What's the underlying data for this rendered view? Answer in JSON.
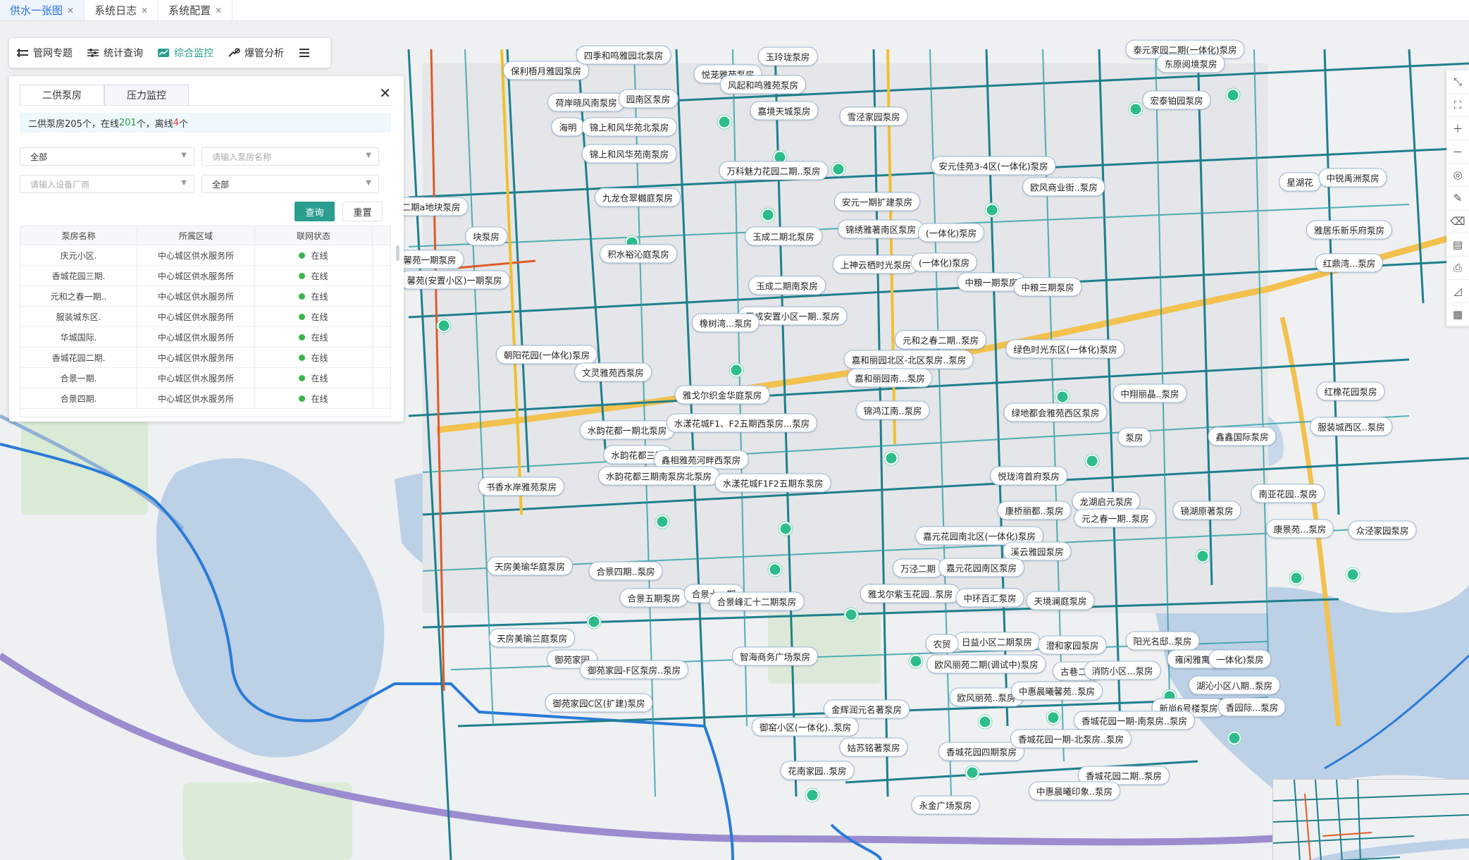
{
  "tabs": [
    {
      "label": "供水一张图",
      "active": true
    },
    {
      "label": "系统日志",
      "active": false
    },
    {
      "label": "系统配置",
      "active": false
    }
  ],
  "toolbar": {
    "items": [
      {
        "label": "管网专题",
        "icon": "pipe-network-icon"
      },
      {
        "label": "统计查询",
        "icon": "sliders-icon"
      },
      {
        "label": "综合监控",
        "icon": "chart-monitor-icon",
        "active": true
      },
      {
        "label": "爆管分析",
        "icon": "burst-analysis-icon"
      }
    ],
    "more_icon": "menu-icon"
  },
  "panel": {
    "tabs": [
      "二供泵房",
      "压力监控"
    ],
    "summary": {
      "prefix": "二供泵房205个，在线",
      "online": "201",
      "mid": "个，离线",
      "offline": "4",
      "suffix": "个"
    },
    "filters": {
      "area": "全部",
      "pump_name_placeholder": "请输入泵房名称",
      "vendor_placeholder": "请输入设备厂商",
      "status": "全部"
    },
    "buttons": {
      "query": "查询",
      "reset": "重置"
    },
    "columns": [
      "泵房名称",
      "所属区域",
      "联网状态"
    ],
    "rows": [
      [
        "庆元小区.",
        "中心城区供水服务所",
        "在线"
      ],
      [
        "香城花园三期.",
        "中心城区供水服务所",
        "在线"
      ],
      [
        "元和之春一期..",
        "中心城区供水服务所",
        "在线"
      ],
      [
        "服装城东区.",
        "中心城区供水服务所",
        "在线"
      ],
      [
        "华城国际.",
        "中心城区供水服务所",
        "在线"
      ],
      [
        "香城花园二期.",
        "中心城区供水服务所",
        "在线"
      ],
      [
        "合景一期.",
        "中心城区供水服务所",
        "在线"
      ],
      [
        "合景四期.",
        "中心城区供水服务所",
        "在线"
      ]
    ]
  },
  "map_labels": [
    "保利梧月雅园泵房",
    "四季和鸣雅园北泵房",
    "玉玲珑泵房",
    "悦茏雅苑泵房",
    "风起和鸣雅苑泵房",
    "荷岸晓风南泵房",
    "园南区泵房",
    "嘉境天城泵房",
    "雪泾家园泵房",
    "海明",
    "锦上和风华苑北泵房",
    "锦上和风华苑南泵房",
    "万科魅力花园二期..泵房",
    "九龙仓翠樾庭泵房",
    "安元佳苑3-4区(一体化)泵房",
    "欧风商业街..泵房",
    "泰元家园二期(一体化)泵房",
    "东原阅境泵房",
    "宏泰铂园泵房",
    "星湖花",
    "中锐禹洲泵房",
    "雅居乐新乐府泵房",
    "红鼎湾...泵房",
    "安元一期扩建泵房",
    "锦绣雅著南区泵房",
    "(一体化)泵房",
    "积水裕沁庭泵房",
    "二期a地块泵房",
    "玉成二期北泵房",
    "上神云栖时光泵房",
    "(一体化)泵房",
    "中粮一期泵房",
    "中粮三期泵房",
    "馨苑一期泵房",
    "馨苑(安置小区)一期泵房",
    "玉成二期南泵房",
    "玉成安置小区一期..泵房",
    "橡树湾...泵房",
    "元和之春二期..泵房",
    "绿色时光东区(一体化)泵房",
    "嘉和丽园北区-北区泵房..泵房",
    "朝阳花园(一体化)泵房",
    "文灵雅苑西泵房",
    "嘉和丽园南...泵房",
    "雅戈尔织金华庭泵房",
    "中翔丽晶..泵房",
    "红橡花园泵房",
    "锦鸿江南..泵房",
    "绿地都会雅苑西区泵房",
    "水韵花都一期北泵房",
    "水漾花城F1、F2五期西泵房...泵房",
    "鑫鑫国际泵房",
    "服装城西区..泵房",
    "水韵花都三期",
    "鑫相雅苑河畔西泵房",
    "水韵花都三期南泵房北泵房",
    "水漾花城F1F2五期东泵房",
    "悦珑湾首府泵房",
    "书香水岸雅苑泵房",
    "龙湖启元泵房",
    "康桥丽都..泵房",
    "元之春一期..泵房",
    "镜湖原著泵房",
    "南亚花园..泵房",
    "康景苑...泵房",
    "众泾家园泵房",
    "嘉元花园南北区(一体化)泵房",
    "溪云雅园泵房",
    "天房美瑜华庭泵房",
    "合景四期..泵房",
    "万泾二期",
    "嘉元花园南区泵房",
    "合景五期泵房",
    "合景十一期",
    "合景峰汇十二期泵房",
    "雅戈尔紫玉花园..泵房",
    "中环百汇泵房",
    "天境澜庭泵房",
    "天房美瑜兰庭泵房",
    "日益小区二期泵房",
    "澄和家园泵房",
    "阳光名邸..泵房",
    "御苑家园",
    "智海商务广场泵房",
    "欧风丽苑二期(调试中)泵房",
    "古巷二社",
    "消防小区...泵房",
    "雍闲雅寓泵房",
    "一体化)泵房",
    "御苑家园-F区泵房..泵房",
    "湖沁小区八期..泵房",
    "御苑家园C区(扩建)泵房",
    "金辉润元名著泵房",
    "欧风丽苑..泵房",
    "中惠晨曦馨苑..泵房",
    "新尚6号楼泵房",
    "香园际...泵房",
    "御窑小区(一体化)..泵房",
    "香城花园一期-南泵房..泵房",
    "姑苏铭著泵房",
    "香城花园四期泵房",
    "香城花园一期-北泵房..泵房",
    "花南家园..泵房",
    "香城花园二期..泵房",
    "永金广场泵房",
    "中惠晨曦印象..泵房",
    "农贸",
    "块泵房",
    "泵房"
  ],
  "right_tools": [
    "measure-icon",
    "fullscreen-icon",
    "zoom-in-icon",
    "zoom-out-icon",
    "locate-icon",
    "draw-icon",
    "erase-icon",
    "layers-icon",
    "print-icon",
    "chart-icon",
    "legend-icon"
  ]
}
